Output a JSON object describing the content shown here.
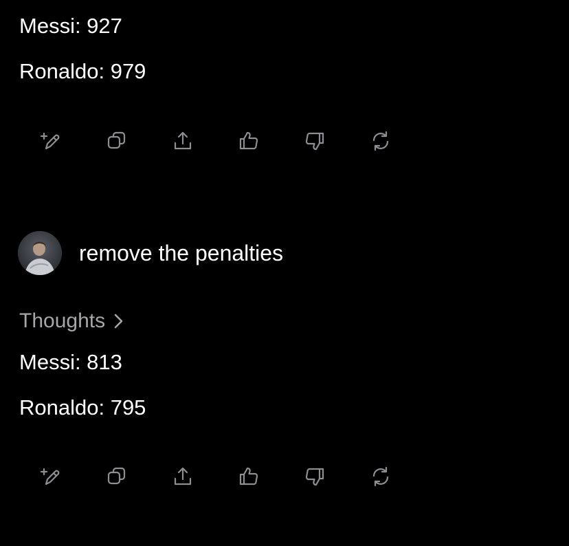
{
  "response_1": {
    "lines": [
      "Messi: 927",
      "Ronaldo: 979"
    ]
  },
  "user_message": {
    "text": "remove the penalties"
  },
  "response_2": {
    "thoughts_label": "Thoughts",
    "lines": [
      "Messi: 813",
      "Ronaldo: 795"
    ]
  },
  "toolbar_icons": [
    "edit-icon",
    "copy-icon",
    "share-icon",
    "thumbs-up-icon",
    "thumbs-down-icon",
    "regenerate-icon"
  ],
  "colors": {
    "background": "#000000",
    "text": "#ffffff",
    "icon": "#8e8e93",
    "muted": "#a6a6ab"
  }
}
